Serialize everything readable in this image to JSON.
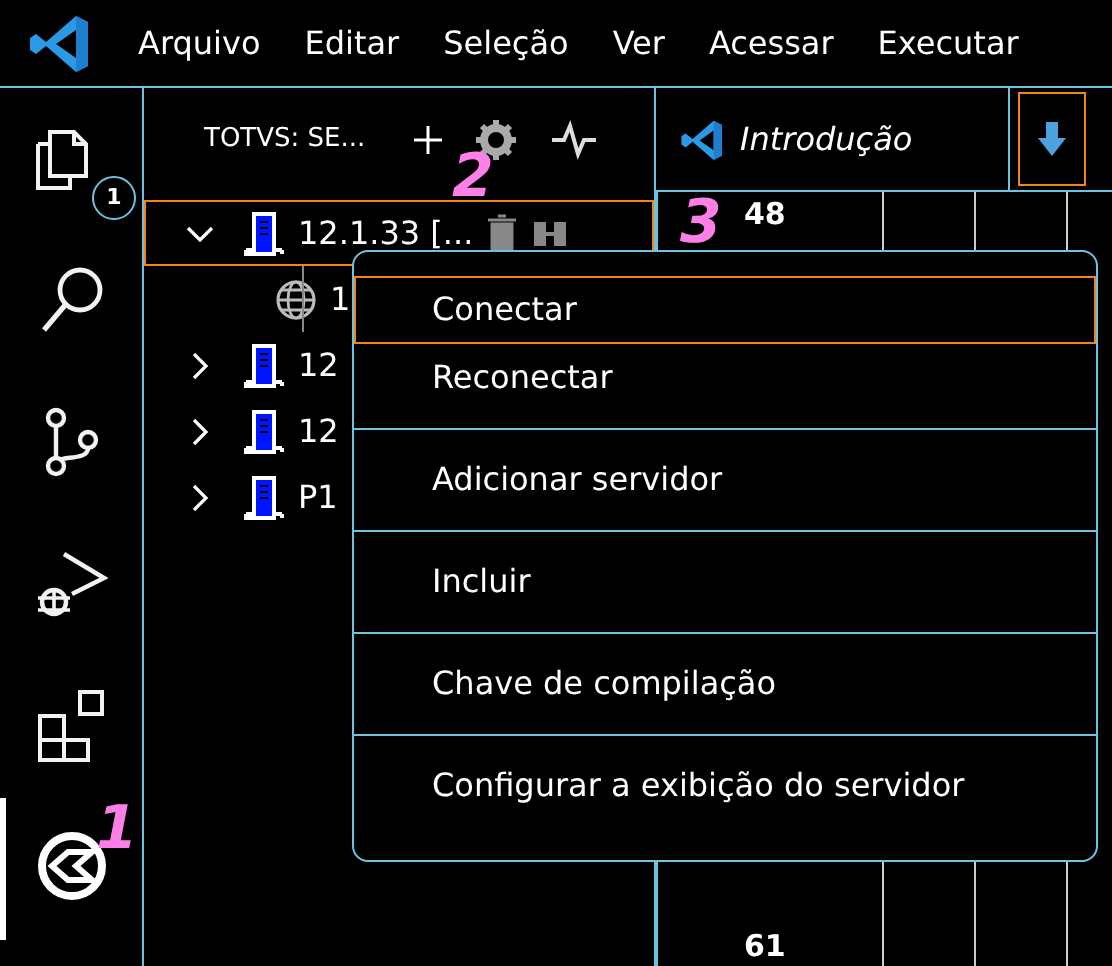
{
  "menubar": {
    "items": [
      "Arquivo",
      "Editar",
      "Seleção",
      "Ver",
      "Acessar",
      "Executar"
    ]
  },
  "activity_bar": {
    "items": [
      {
        "kind": "files",
        "badge": "1",
        "selected": false
      },
      {
        "kind": "search",
        "selected": false
      },
      {
        "kind": "scm",
        "selected": false
      },
      {
        "kind": "debug",
        "selected": false
      },
      {
        "kind": "extensions",
        "selected": false
      },
      {
        "kind": "totvs",
        "selected": true
      }
    ]
  },
  "sidebar": {
    "title": "TOTVS: SE...",
    "tree": [
      {
        "label": "12.1.33 [...",
        "kind": "server",
        "expanded": true,
        "selected": true,
        "children": [
          {
            "label": "1",
            "kind": "environment"
          }
        ]
      },
      {
        "label": "12",
        "kind": "server",
        "expanded": false,
        "selected": false
      },
      {
        "label": "12",
        "kind": "server",
        "expanded": false,
        "selected": false
      },
      {
        "label": "P1",
        "kind": "server",
        "expanded": false,
        "selected": false
      }
    ]
  },
  "editor": {
    "tabs": [
      {
        "label": "Introdução",
        "kind": "welcome",
        "selected": false
      },
      {
        "kind": "download",
        "selected": true
      }
    ],
    "cells": [
      "48",
      "61"
    ]
  },
  "context_menu": {
    "groups": [
      [
        {
          "label": "Conectar",
          "selected": true
        },
        {
          "label": "Reconectar",
          "selected": false
        }
      ],
      [
        {
          "label": "Adicionar servidor",
          "selected": false
        }
      ],
      [
        {
          "label": "Incluir",
          "selected": false
        }
      ],
      [
        {
          "label": "Chave de compilação",
          "selected": false
        }
      ],
      [
        {
          "label": "Configurar a exibição do servidor",
          "selected": false
        }
      ]
    ]
  },
  "annotations": [
    "1",
    "2",
    "3"
  ]
}
